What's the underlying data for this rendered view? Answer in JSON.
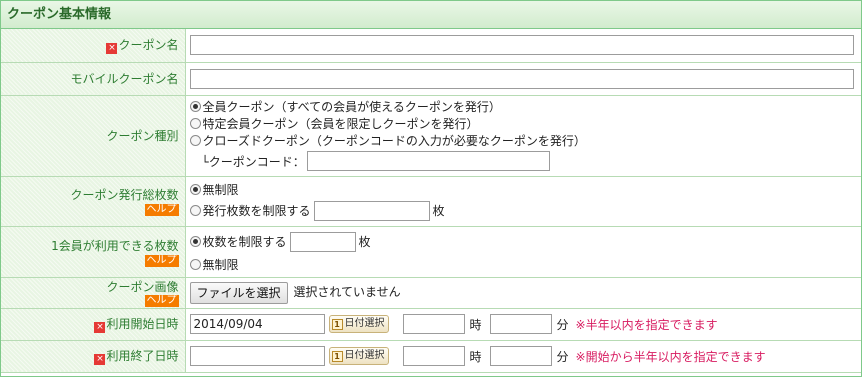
{
  "section": {
    "title": "クーポン基本情報"
  },
  "rows": {
    "coupon_name": {
      "label": "クーポン名",
      "req_mark": "×",
      "value": ""
    },
    "mobile_name": {
      "label": "モバイルクーポン名",
      "value": ""
    },
    "coupon_type": {
      "label": "クーポン種別",
      "options": [
        "全員クーポン（すべての会員が使えるクーポンを発行）",
        "特定会員クーポン（会員を限定しクーポンを発行）",
        "クローズドクーポン（クーポンコードの入力が必要なクーポンを発行）"
      ],
      "selected_index": 0,
      "code_label": "└クーポンコード：",
      "code_value": ""
    },
    "total_count": {
      "label": "クーポン発行総枚数",
      "help": "ヘルプ",
      "options": [
        "無制限",
        "発行枚数を制限する"
      ],
      "selected_index": 0,
      "unit": "枚",
      "value": ""
    },
    "per_member": {
      "label": "1会員が利用できる枚数",
      "help": "ヘルプ",
      "options": [
        "枚数を制限する",
        "無制限"
      ],
      "selected_index": 0,
      "unit": "枚",
      "value": ""
    },
    "image": {
      "label": "クーポン画像",
      "help": "ヘルプ",
      "button": "ファイルを選択",
      "status": "選択されていません"
    },
    "start": {
      "label": "利用開始日時",
      "req_mark": "×",
      "date": "2014/09/04",
      "date_button": "日付選択",
      "cal_icon": "1",
      "hour_unit": "時",
      "minute_unit": "分",
      "hour": "",
      "minute": "",
      "note": "※半年以内を指定できます"
    },
    "end": {
      "label": "利用終了日時",
      "req_mark": "×",
      "date": "",
      "date_button": "日付選択",
      "cal_icon": "1",
      "hour_unit": "時",
      "minute_unit": "分",
      "hour": "",
      "minute": "",
      "note": "※開始から半年以内を指定できます"
    }
  },
  "colors": {
    "label_text": "#2e7d32",
    "note": "#d81b60",
    "help_bg": "#f57c00",
    "required": "#e53935"
  },
  "icons": {
    "required": "required-icon",
    "calendar": "calendar-icon"
  }
}
